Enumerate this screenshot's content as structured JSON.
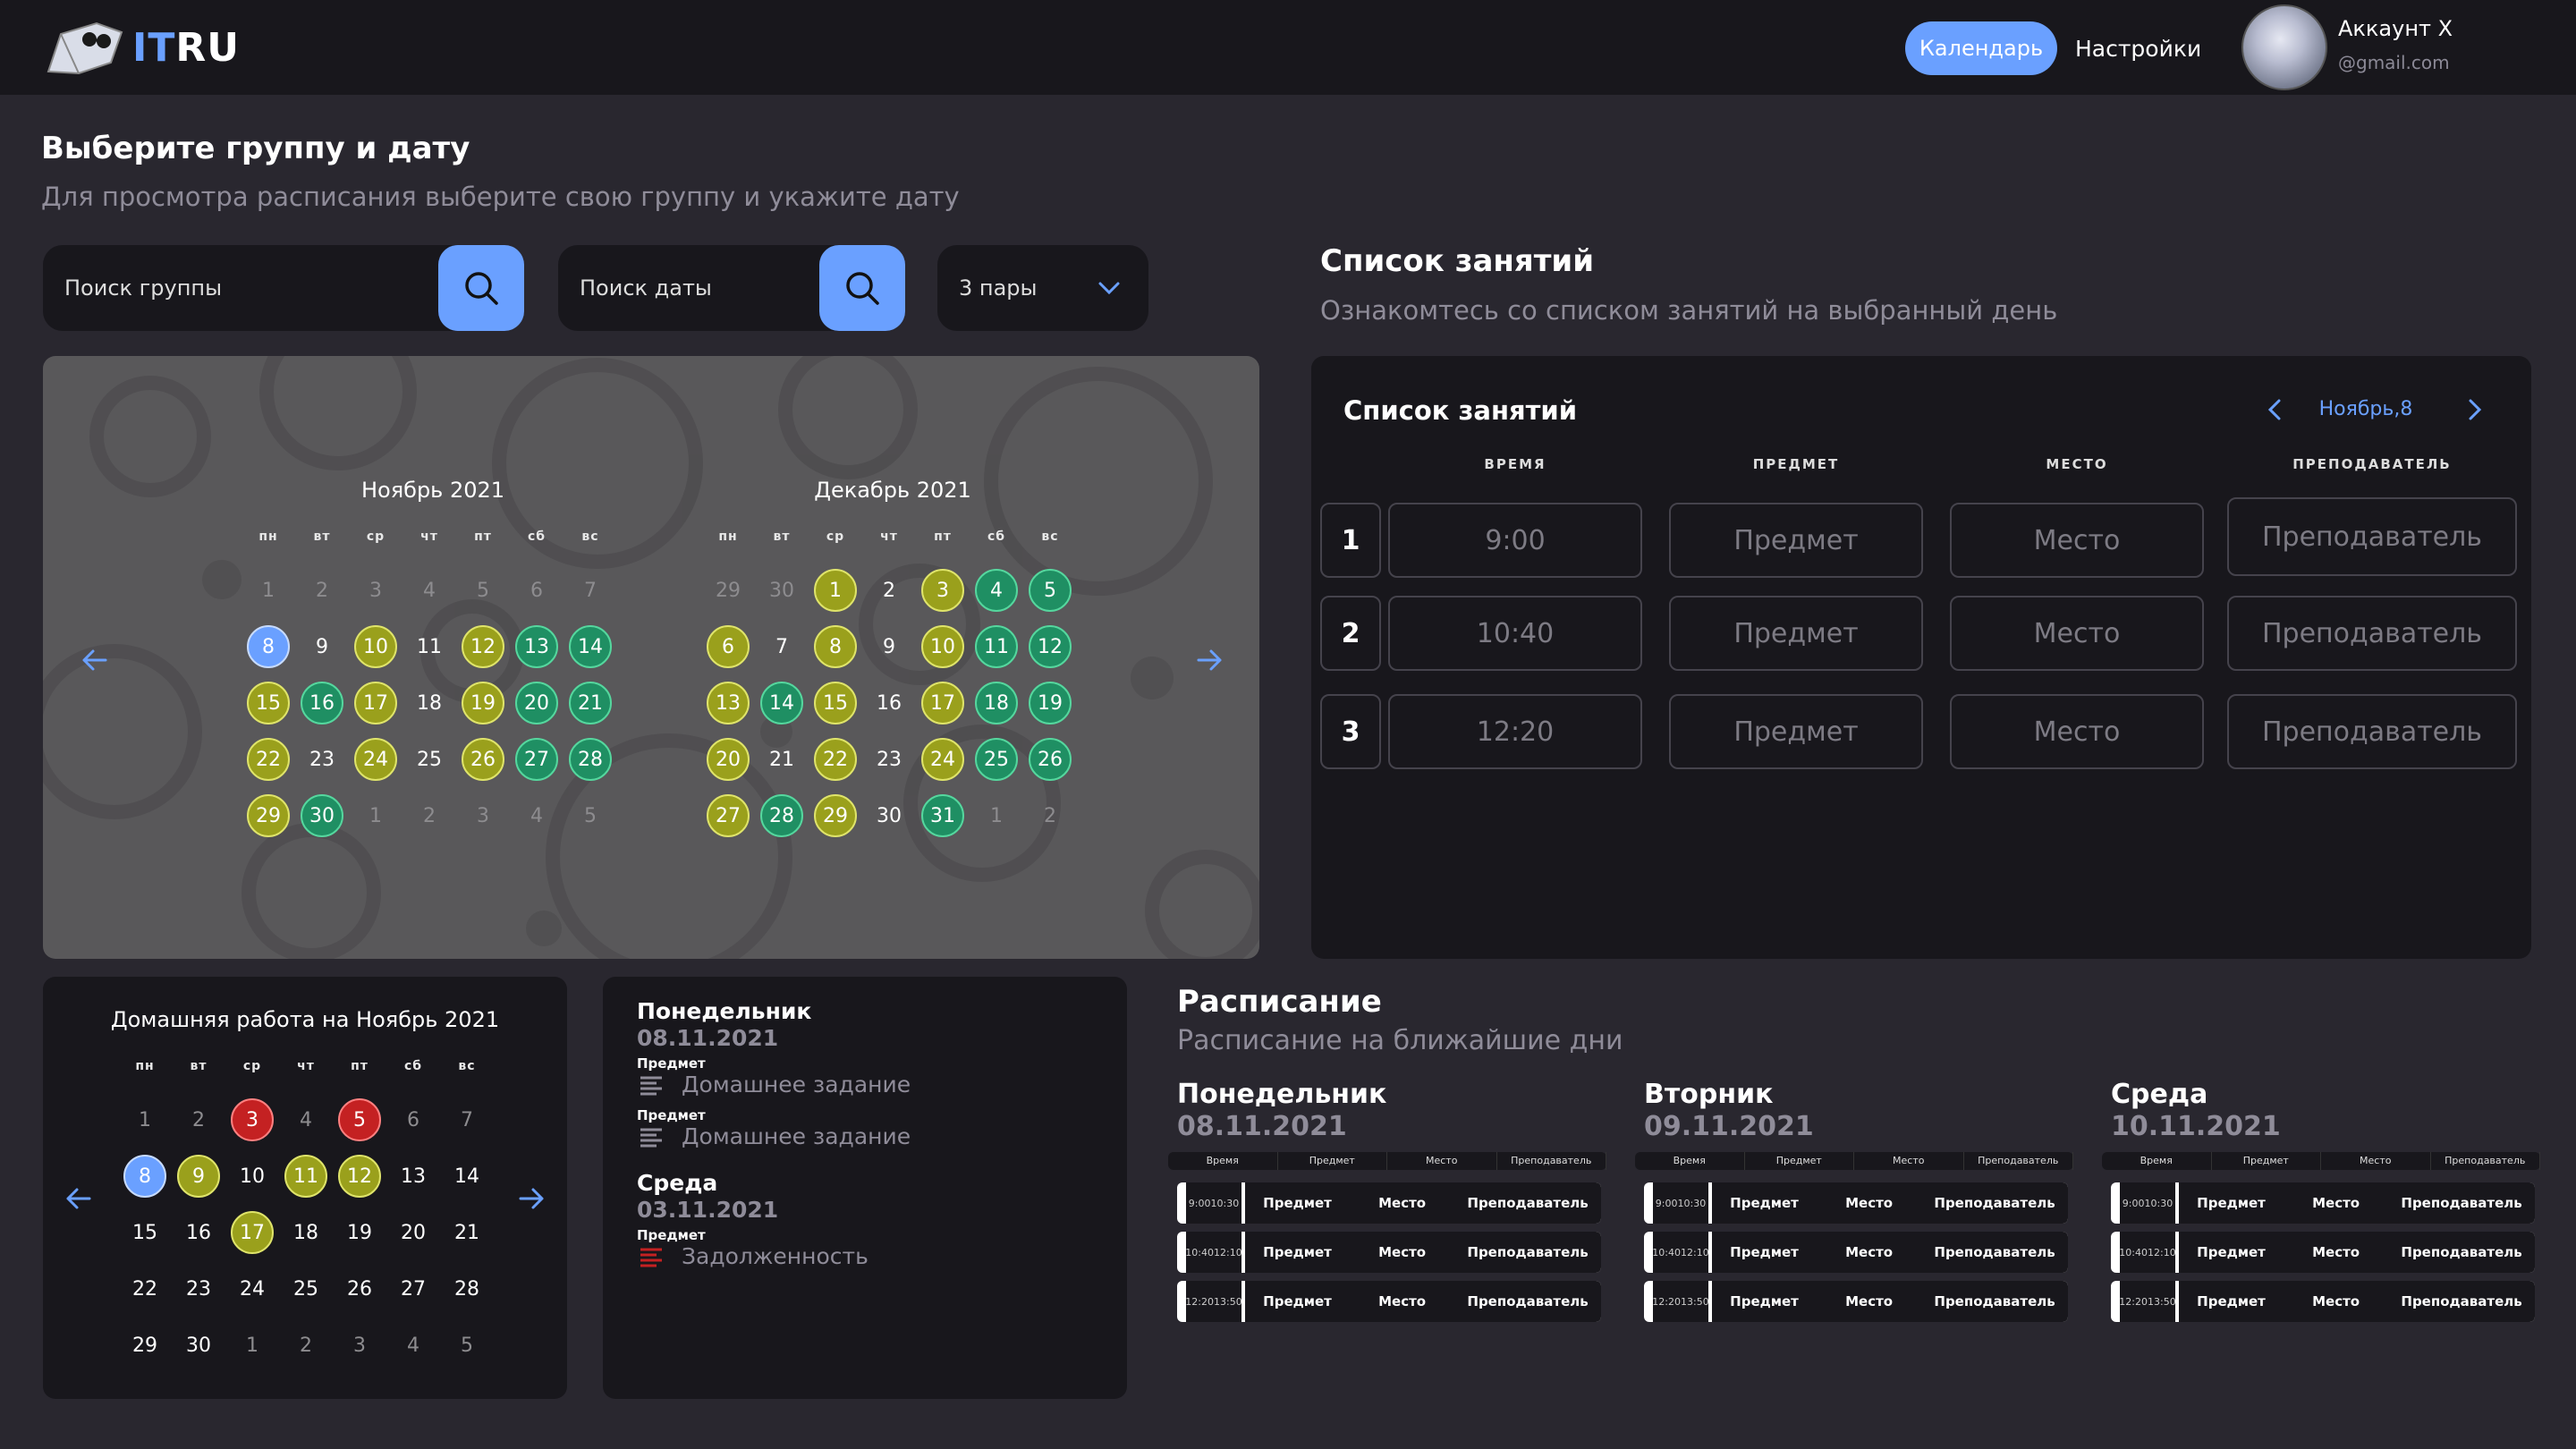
{
  "header": {
    "logo_it": "IT",
    "logo_ru": "RU",
    "nav_calendar": "Календарь",
    "nav_settings": "Настройки",
    "account_name": "Аккаунт X",
    "account_email": "@gmail.com"
  },
  "select": {
    "title": "Выберите группу и дату",
    "subtitle": "Для просмотра расписания выберите свою группу и укажите дату",
    "group_placeholder": "Поиск группы",
    "date_placeholder": "Поиск даты",
    "pairs_value": "3 пары"
  },
  "weekdays": [
    "пн",
    "вт",
    "ср",
    "чт",
    "пт",
    "сб",
    "вс"
  ],
  "calendar": {
    "months": [
      {
        "title": "Ноябрь 2021",
        "weeks": [
          [
            "1",
            "2",
            "3",
            "4",
            "5",
            "6",
            "7"
          ],
          [
            "8",
            "9",
            "10",
            "11",
            "12",
            "13",
            "14"
          ],
          [
            "15",
            "16",
            "17",
            "18",
            "19",
            "20",
            "21"
          ],
          [
            "22",
            "23",
            "24",
            "25",
            "26",
            "27",
            "28"
          ],
          [
            "29",
            "30",
            "1",
            "2",
            "3",
            "4",
            "5"
          ]
        ],
        "states": [
          [
            "m",
            "m",
            "m",
            "m",
            "m",
            "m",
            "m"
          ],
          [
            "b",
            "",
            "y",
            "",
            "y",
            "g",
            "g"
          ],
          [
            "y",
            "g",
            "y",
            "",
            "y",
            "g",
            "g"
          ],
          [
            "y",
            "",
            "y",
            "",
            "y",
            "g",
            "g"
          ],
          [
            "y",
            "g",
            "m",
            "m",
            "m",
            "m",
            "m"
          ]
        ]
      },
      {
        "title": "Декабрь 2021",
        "weeks": [
          [
            "29",
            "30",
            "1",
            "2",
            "3",
            "4",
            "5"
          ],
          [
            "6",
            "7",
            "8",
            "9",
            "10",
            "11",
            "12"
          ],
          [
            "13",
            "14",
            "15",
            "16",
            "17",
            "18",
            "19"
          ],
          [
            "20",
            "21",
            "22",
            "23",
            "24",
            "25",
            "26"
          ],
          [
            "27",
            "28",
            "29",
            "30",
            "31",
            "1",
            "2"
          ]
        ],
        "states": [
          [
            "m",
            "m",
            "y",
            "",
            "y",
            "g",
            "g"
          ],
          [
            "y",
            "",
            "y",
            "",
            "y",
            "g",
            "g"
          ],
          [
            "y",
            "g",
            "y",
            "",
            "y",
            "g",
            "g"
          ],
          [
            "y",
            "",
            "y",
            "",
            "y",
            "g",
            "g"
          ],
          [
            "y",
            "g",
            "y",
            "",
            "g",
            "m",
            "m"
          ]
        ]
      }
    ]
  },
  "lessons": {
    "title": "Список занятий",
    "subtitle": "Ознакомтесь со списком занятий на выбранный день",
    "panel_title": "Список занятий",
    "date_label": "Ноябрь,8",
    "columns": [
      "ВРЕМЯ",
      "ПРЕДМЕТ",
      "МЕСТО",
      "ПРЕПОДАВАТЕЛЬ"
    ],
    "rows": [
      {
        "num": "1",
        "time": "9:00",
        "subject": "Предмет",
        "place": "Место",
        "teacher": "Преподаватель"
      },
      {
        "num": "2",
        "time": "10:40",
        "subject": "Предмет",
        "place": "Место",
        "teacher": "Преподаватель"
      },
      {
        "num": "3",
        "time": "12:20",
        "subject": "Предмет",
        "place": "Место",
        "teacher": "Преподаватель"
      }
    ]
  },
  "homework_calendar": {
    "title": "Домашняя работа на Ноябрь 2021",
    "weeks": [
      [
        "1",
        "2",
        "3",
        "4",
        "5",
        "6",
        "7"
      ],
      [
        "8",
        "9",
        "10",
        "11",
        "12",
        "13",
        "14"
      ],
      [
        "15",
        "16",
        "17",
        "18",
        "19",
        "20",
        "21"
      ],
      [
        "22",
        "23",
        "24",
        "25",
        "26",
        "27",
        "28"
      ],
      [
        "29",
        "30",
        "1",
        "2",
        "3",
        "4",
        "5"
      ]
    ],
    "states": [
      [
        "m",
        "m",
        "r",
        "m",
        "r",
        "m",
        "m"
      ],
      [
        "b",
        "y",
        "",
        "y",
        "y",
        "",
        ""
      ],
      [
        "",
        "",
        "y",
        "",
        "",
        "",
        ""
      ],
      [
        "",
        "",
        "",
        "",
        "",
        "",
        ""
      ],
      [
        "",
        "",
        "m",
        "m",
        "m",
        "m",
        "m"
      ]
    ]
  },
  "homework": {
    "entries": [
      {
        "day": "Понедельник",
        "date": "08.11.2021",
        "items": [
          {
            "label": "Предмет",
            "text": "Домашнее задание",
            "color": "#8f8c99"
          },
          {
            "label": "Предмет",
            "text": "Домашнее задание",
            "color": "#8f8c99"
          }
        ]
      },
      {
        "day": "Среда",
        "date": "03.11.2021",
        "items": [
          {
            "label": "Предмет",
            "text": "Задолженность",
            "color": "#c42122"
          }
        ]
      }
    ]
  },
  "schedule": {
    "title": "Расписание",
    "subtitle": "Расписание на ближайшие дни",
    "head": [
      "Время",
      "Предмет",
      "Место",
      "Преподаватель"
    ],
    "days": [
      {
        "day": "Понедельник",
        "date": "08.11.2021",
        "rows": [
          {
            "t1": "9:00",
            "t2": "10:30"
          },
          {
            "t1": "10:40",
            "t2": "12:10"
          },
          {
            "t1": "12:20",
            "t2": "13:50"
          }
        ]
      },
      {
        "day": "Вторник",
        "date": "09.11.2021",
        "rows": [
          {
            "t1": "9:00",
            "t2": "10:30"
          },
          {
            "t1": "10:40",
            "t2": "12:10"
          },
          {
            "t1": "12:20",
            "t2": "13:50"
          }
        ]
      },
      {
        "day": "Среда",
        "date": "10.11.2021",
        "rows": [
          {
            "t1": "9:00",
            "t2": "10:30"
          },
          {
            "t1": "10:40",
            "t2": "12:10"
          },
          {
            "t1": "12:20",
            "t2": "13:50"
          }
        ]
      }
    ],
    "cell_subject": "Предмет",
    "cell_place": "Место",
    "cell_teacher": "Преподаватель"
  },
  "colors": {
    "accent": "#6aa0ff",
    "yellow": "#9aa01c",
    "green": "#1f8f63",
    "red": "#c42122",
    "bg": "#29272f",
    "panel": "#18171c"
  },
  "icons": [
    "logo-book-icon",
    "search-icon",
    "chevron-down-icon",
    "arrow-left-icon",
    "arrow-right-icon",
    "chevron-left-icon",
    "chevron-right-icon",
    "text-lines-icon"
  ]
}
